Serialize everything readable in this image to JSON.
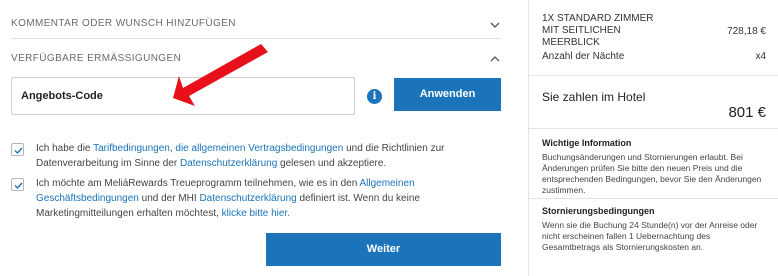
{
  "accordion": {
    "comment_label": "KOMMENTAR ODER WUNSCH HINZUFÜGEN",
    "discounts_label": "VERFÜGBARE ERMÄSSIGUNGEN"
  },
  "promo": {
    "placeholder": "Angebots-Code",
    "apply_label": "Anwenden",
    "info_glyph": "i"
  },
  "consent1": {
    "t1": "Ich habe die ",
    "link1": "Tarifbedingungen",
    "t2": ", ",
    "link2": "die allgemeinen Vertragsbedingungen",
    "t3": " und die Richtlinien zur Datenverarbeitung im Sinne der ",
    "link3": "Datenschutzerklärung",
    "t4": " gelesen und akzeptiere."
  },
  "consent2": {
    "t1": "Ich möchte am MeliáRewards Treueprogramm teilnehmen, wie es in den ",
    "link1": "Allgemeinen Geschäftsbedingungen",
    "t2": " und der MHI ",
    "link2": "Datenschutzerklärung",
    "t3": " definiert ist. Wenn du keine Marketingmitteilungen erhalten möchtest, ",
    "link3": "klicke bitte hier."
  },
  "continue_label": "Weiter",
  "summary": {
    "room": "1x STANDARD ZIMMER MIT SEITLICHEN MEERBLICK",
    "room_price": "728,18 €",
    "nights_label": "Anzahl der Nächte",
    "nights_value": "x4",
    "pay_label": "Sie zahlen im Hotel",
    "pay_total": "801 €",
    "info_title": "Wichtige Information",
    "info_text": "Buchungsänderungen und Stornierungen erlaubt. Bei Änderungen prüfen Sie bitte den neuen Preis und die entsprechenden Bedingungen, bevor Sie den Änderungen zustimmen.",
    "cancel_title": "Stornierungsbedingungen",
    "cancel_text": "Wenn sie die Buchung 24 Stunde(n) vor der Anreise oder nicht erscheinen fallen 1 Uebernachtung des Gesamtbetrags als Stornierungskosten an."
  },
  "colors": {
    "accent": "#1b73b9",
    "arrow": "#e8101a"
  },
  "icons": {
    "chevron_down": "chevron-down-icon",
    "chevron_up": "chevron-up-icon",
    "info": "info-icon",
    "check": "checkmark-icon"
  }
}
